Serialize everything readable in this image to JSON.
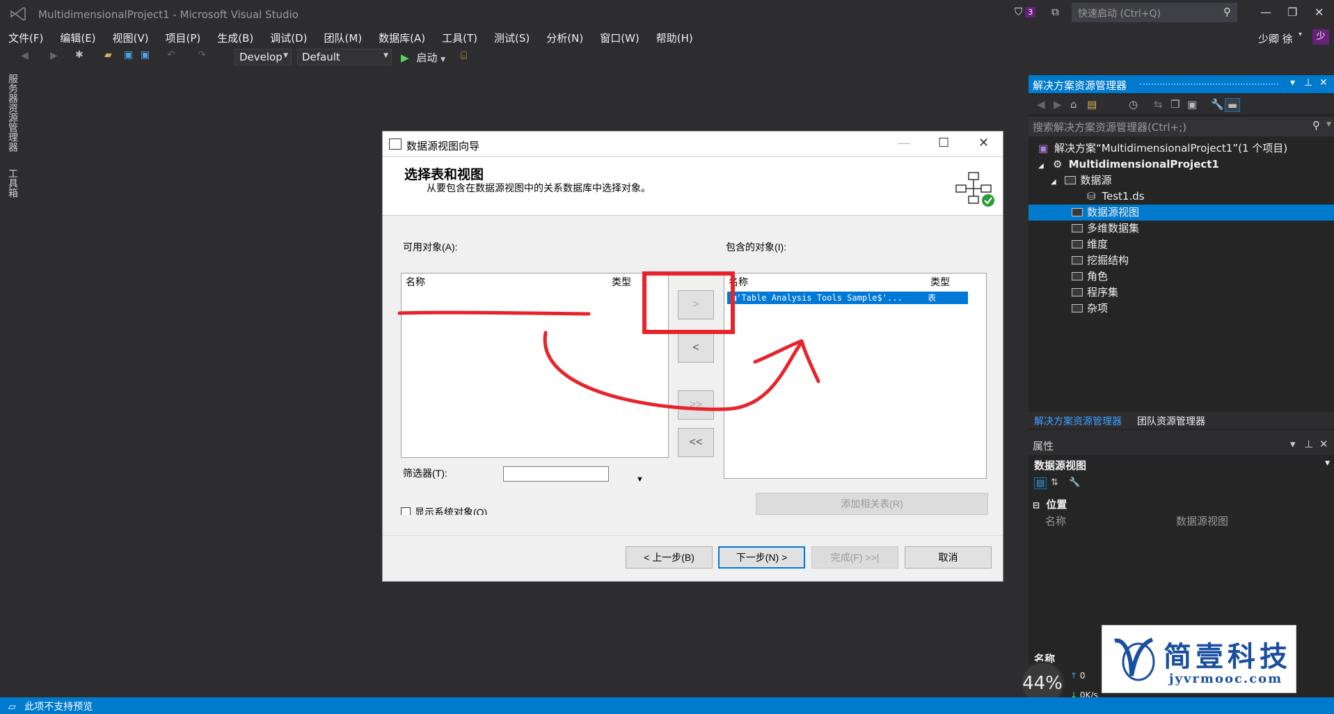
{
  "window": {
    "title": "MultidimensionalProject1 - Microsoft Visual Studio",
    "notification_count": "3",
    "quick_launch_placeholder": "快速启动 (Ctrl+Q)",
    "user_name": "少卿 徐",
    "user_initial": "少"
  },
  "menu": [
    "文件(F)",
    "编辑(E)",
    "视图(V)",
    "项目(P)",
    "生成(B)",
    "调试(D)",
    "团队(M)",
    "数据库(A)",
    "工具(T)",
    "测试(S)",
    "分析(N)",
    "窗口(W)",
    "帮助(H)"
  ],
  "toolbar": {
    "config": "Develop",
    "platform": "Default",
    "start_label": "启动"
  },
  "side_tabs": [
    "服务器资源管理器",
    "工具箱"
  ],
  "solution_explorer": {
    "title": "解决方案资源管理器",
    "search_placeholder": "搜索解决方案资源管理器(Ctrl+;)",
    "solution": "解决方案“MultidimensionalProject1”(1 个项目)",
    "project": "MultidimensionalProject1",
    "items": [
      {
        "label": "数据源",
        "level": 2,
        "expanded": true
      },
      {
        "label": "Test1.ds",
        "level": 3
      },
      {
        "label": "数据源视图",
        "level": 2,
        "selected": true
      },
      {
        "label": "多维数据集",
        "level": 2
      },
      {
        "label": "维度",
        "level": 2
      },
      {
        "label": "挖掘结构",
        "level": 2
      },
      {
        "label": "角色",
        "level": 2
      },
      {
        "label": "程序集",
        "level": 2
      },
      {
        "label": "杂项",
        "level": 2
      }
    ],
    "tabs": [
      "解决方案资源管理器",
      "团队资源管理器"
    ]
  },
  "properties": {
    "title": "属性",
    "object": "数据源视图",
    "category": "位置",
    "row_name": "名称",
    "row_value": "数据源视图",
    "footer_label": "名称"
  },
  "dialog": {
    "title": "数据源视图向导",
    "heading": "选择表和视图",
    "subheading": "从要包含在数据源视图中的关系数据库中选择对象。",
    "available_label": "可用对象(A):",
    "included_label": "包含的对象(I):",
    "col_name": "名称",
    "col_type": "类型",
    "included_rows": [
      {
        "name": "'Table Analysis Tools Sample$'...",
        "type": "表"
      }
    ],
    "move_right": ">",
    "move_left": "<",
    "move_all_right": ">>",
    "move_all_left": "<<",
    "filter_label": "筛选器(T):",
    "show_system": "显示系统对象(O)",
    "add_related": "添加相关表(R)",
    "back": "< 上一步(B)",
    "next": "下一步(N) >",
    "finish": "完成(F) >>|",
    "cancel": "取消"
  },
  "status_bar": {
    "text": "此项不支持预览"
  },
  "overlay": {
    "gauge_percent": "44%",
    "speed_up": "0",
    "speed_down": "0",
    "speed_unit": "K/s",
    "watermark_name": "简壹科技",
    "watermark_url": "jyvrmooc.com"
  },
  "colors": {
    "accent": "#007acc",
    "annotation_red": "#e8232b",
    "selection_blue": "#0078d7"
  }
}
